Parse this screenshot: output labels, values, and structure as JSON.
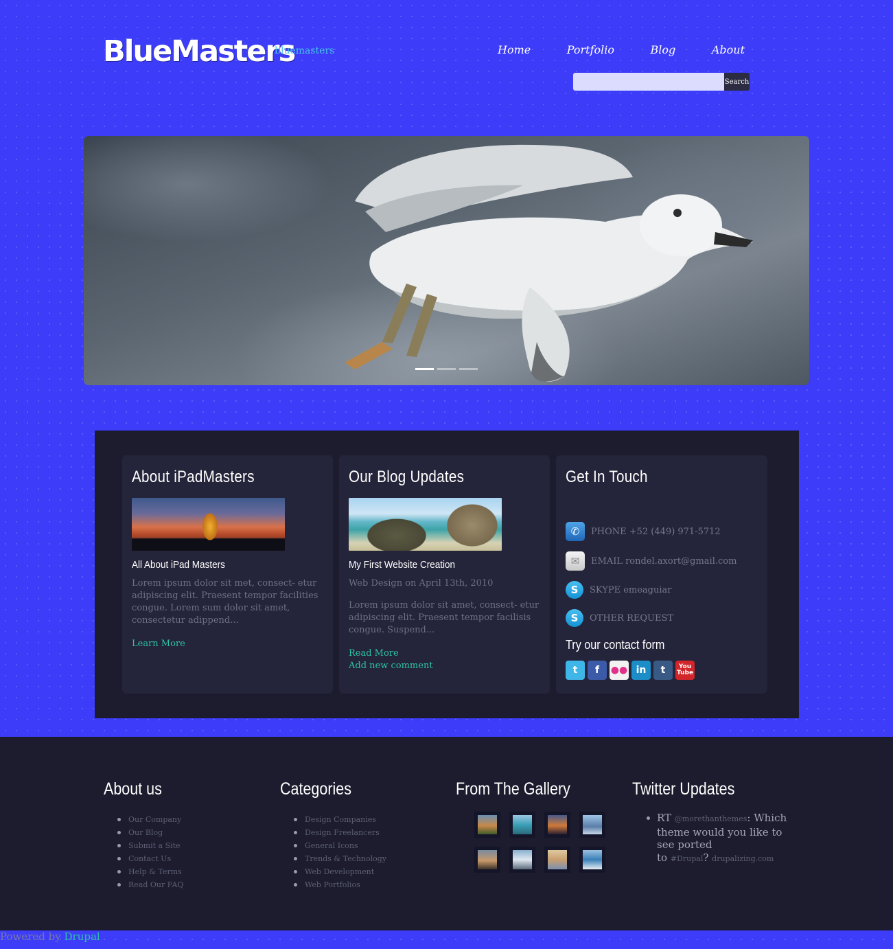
{
  "site": {
    "logo": "BlueMasters",
    "slogan": "bluemasters"
  },
  "nav": {
    "items": [
      "Home",
      "Portfolio",
      "Blog",
      "About"
    ]
  },
  "search": {
    "placeholder": "",
    "button_label": "Search"
  },
  "slider": {
    "slide_count": 3,
    "active_slide": 1
  },
  "content": {
    "about": {
      "title": "About iPadMasters",
      "subtitle": "All About iPad Masters",
      "text": "Lorem ipsum dolor sit met, consect- etur adipiscing elit. Praesent tempor facilities congue. Lorem sum dolor sit amet, consectetur adippend...",
      "link": "Learn More"
    },
    "blog": {
      "title": "Our Blog Updates",
      "post_title": "My First Website Creation",
      "meta": "Web Design on April 13th, 2010",
      "text": "Lorem ipsum dolor sit amet, consect- etur adipiscing elit. Praesent tempor facilisis congue. Suspend...",
      "read_more": "Read More",
      "add_comment": "Add new comment"
    },
    "contact": {
      "title": "Get In Touch",
      "phone": "PHONE +52 (449) 971-5712",
      "email": "EMAIL rondel.axort@gmail.com",
      "skype": "SKYPE emeaguiar",
      "other": "OTHER REQUEST",
      "form_title": "Try our contact form",
      "social": [
        "twitter-icon",
        "facebook-icon",
        "flickr-icon",
        "linkedin-icon",
        "tumblr-icon",
        "youtube-icon"
      ]
    }
  },
  "footer": {
    "about": {
      "title": "About us",
      "items": [
        "Our Company",
        "Our Blog",
        "Submit a Site",
        "Contact Us",
        "Help & Terms",
        "Read Our FAQ"
      ]
    },
    "categories": {
      "title": "Categories",
      "items": [
        "Design Companies",
        "Design Freelancers",
        "General Icons",
        "Trends & Technology",
        "Web Development",
        "Web Portfolios"
      ]
    },
    "gallery": {
      "title": "From The Gallery",
      "thumb_count": 8
    },
    "twitter": {
      "title": "Twitter Updates",
      "rt": "RT",
      "handle": "@morethanthemes",
      "text1": ": Which theme would you like to see ported",
      "to": "to",
      "hashtag": "#Drupal",
      "q": "?",
      "link": "drupalizing.com"
    }
  },
  "powered": {
    "prefix": "Powered by",
    "link": "Drupal"
  },
  "colors": {
    "background": "#3c3cf9",
    "panel": "#1c1c2e",
    "card": "#24243a",
    "accent_link": "#2ec4a4",
    "slogan": "#45c4e8"
  }
}
